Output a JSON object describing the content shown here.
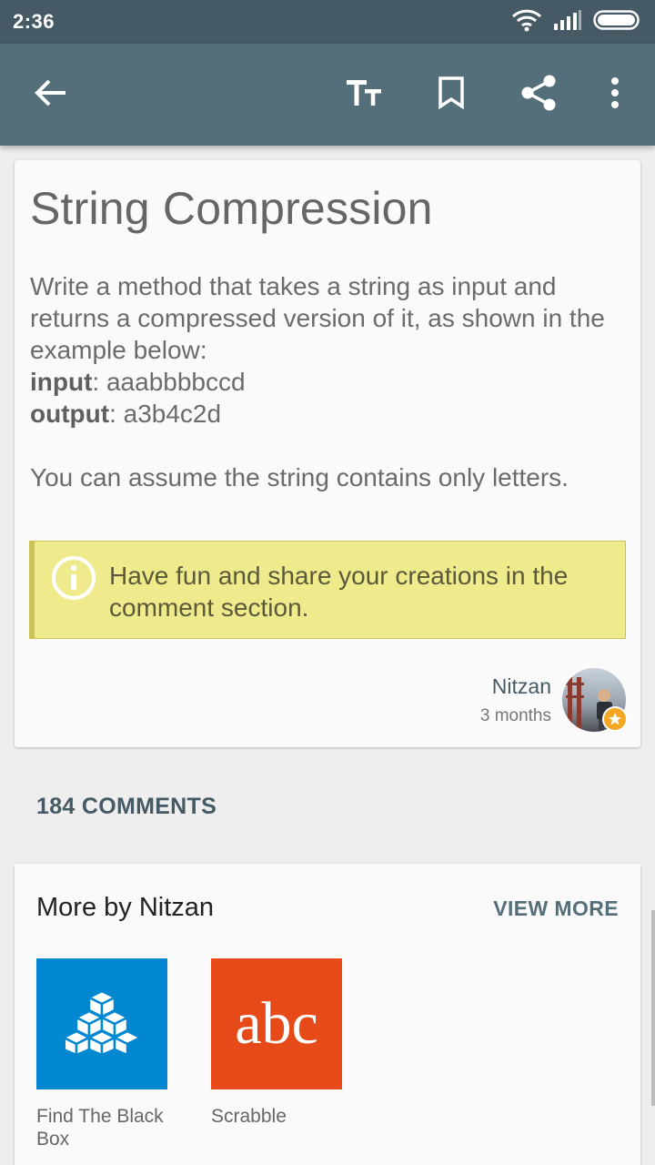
{
  "status_bar": {
    "time": "2:36"
  },
  "toolbar": {
    "back_icon": "arrow-back-icon",
    "text_size_icon": "text-size-icon",
    "bookmark_icon": "bookmark-icon",
    "share_icon": "share-icon",
    "more_icon": "more-vert-icon"
  },
  "article": {
    "title": "String Compression",
    "description": "Write a method that takes a string as input and returns a compressed version of it, as shown in the example below:",
    "input_label": "input",
    "input_value": ": aaabbbbccd",
    "output_label": "output",
    "output_value": ": a3b4c2d",
    "assumption": "You can assume the string contains only letters.",
    "note": "Have fun and share your creations in the comment section.",
    "author": {
      "name": "Nitzan",
      "time": "3 months"
    }
  },
  "comments": {
    "count_label": "184 COMMENTS"
  },
  "more_by": {
    "title": "More by Nitzan",
    "view_more": "VIEW MORE",
    "items": [
      {
        "label": "Find The Black Box",
        "color": "#0288d1",
        "icon": "cubes-icon"
      },
      {
        "label": "Scrabble",
        "color": "#e64a19",
        "icon_text": "abc"
      }
    ]
  },
  "colors": {
    "status_bar": "#455a64",
    "app_bar": "#546e7a",
    "note_background": "#efeb8c",
    "accent": "#546e7a"
  }
}
